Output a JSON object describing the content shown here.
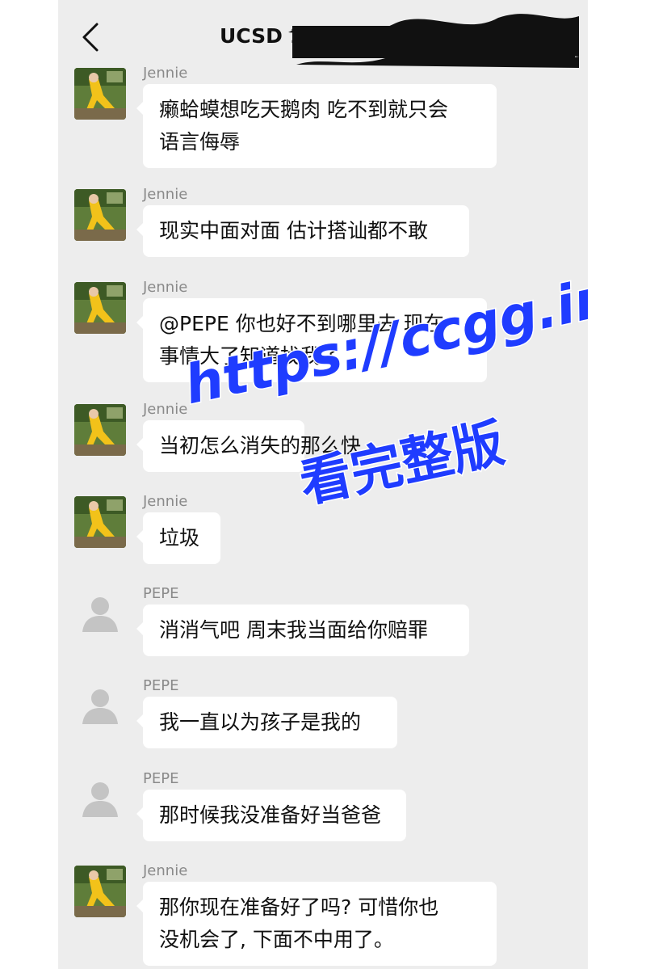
{
  "header": {
    "back_icon": "chevron-left-icon",
    "title": "UCSD 1"
  },
  "messages": [
    {
      "sender": "Jennie",
      "avatar": "photo",
      "lines": [
        "癞蛤蟆想吃天鹅肉 吃不到就只会",
        "语言侮辱"
      ]
    },
    {
      "sender": "Jennie",
      "avatar": "photo",
      "lines": [
        "现实中面对面 估计搭讪都不敢"
      ]
    },
    {
      "sender": "Jennie",
      "avatar": "photo",
      "lines": [
        "@PEPE 你也好不到哪里去 现在",
        "事情大了知道找我了"
      ]
    },
    {
      "sender": "Jennie",
      "avatar": "photo",
      "lines": [
        "当初怎么消失的那么快"
      ]
    },
    {
      "sender": "Jennie",
      "avatar": "photo",
      "lines": [
        "垃圾"
      ]
    },
    {
      "sender": "PEPE",
      "avatar": "default",
      "lines": [
        "消消气吧 周末我当面给你赔罪"
      ]
    },
    {
      "sender": "PEPE",
      "avatar": "default",
      "lines": [
        "我一直以为孩子是我的"
      ]
    },
    {
      "sender": "PEPE",
      "avatar": "default",
      "lines": [
        "那时候我没准备好当爸爸"
      ]
    },
    {
      "sender": "Jennie",
      "avatar": "photo",
      "lines": [
        "那你现在准备好了吗? 可惜你也",
        "没机会了, 下面不中用了。"
      ]
    }
  ],
  "watermark": {
    "line1": "https://ccgg.ink",
    "line2": "看完整版",
    "color": "#1f3cff"
  },
  "colors": {
    "background": "#ededed",
    "bubble": "#ffffff",
    "sender_text": "#8a8a8a"
  }
}
